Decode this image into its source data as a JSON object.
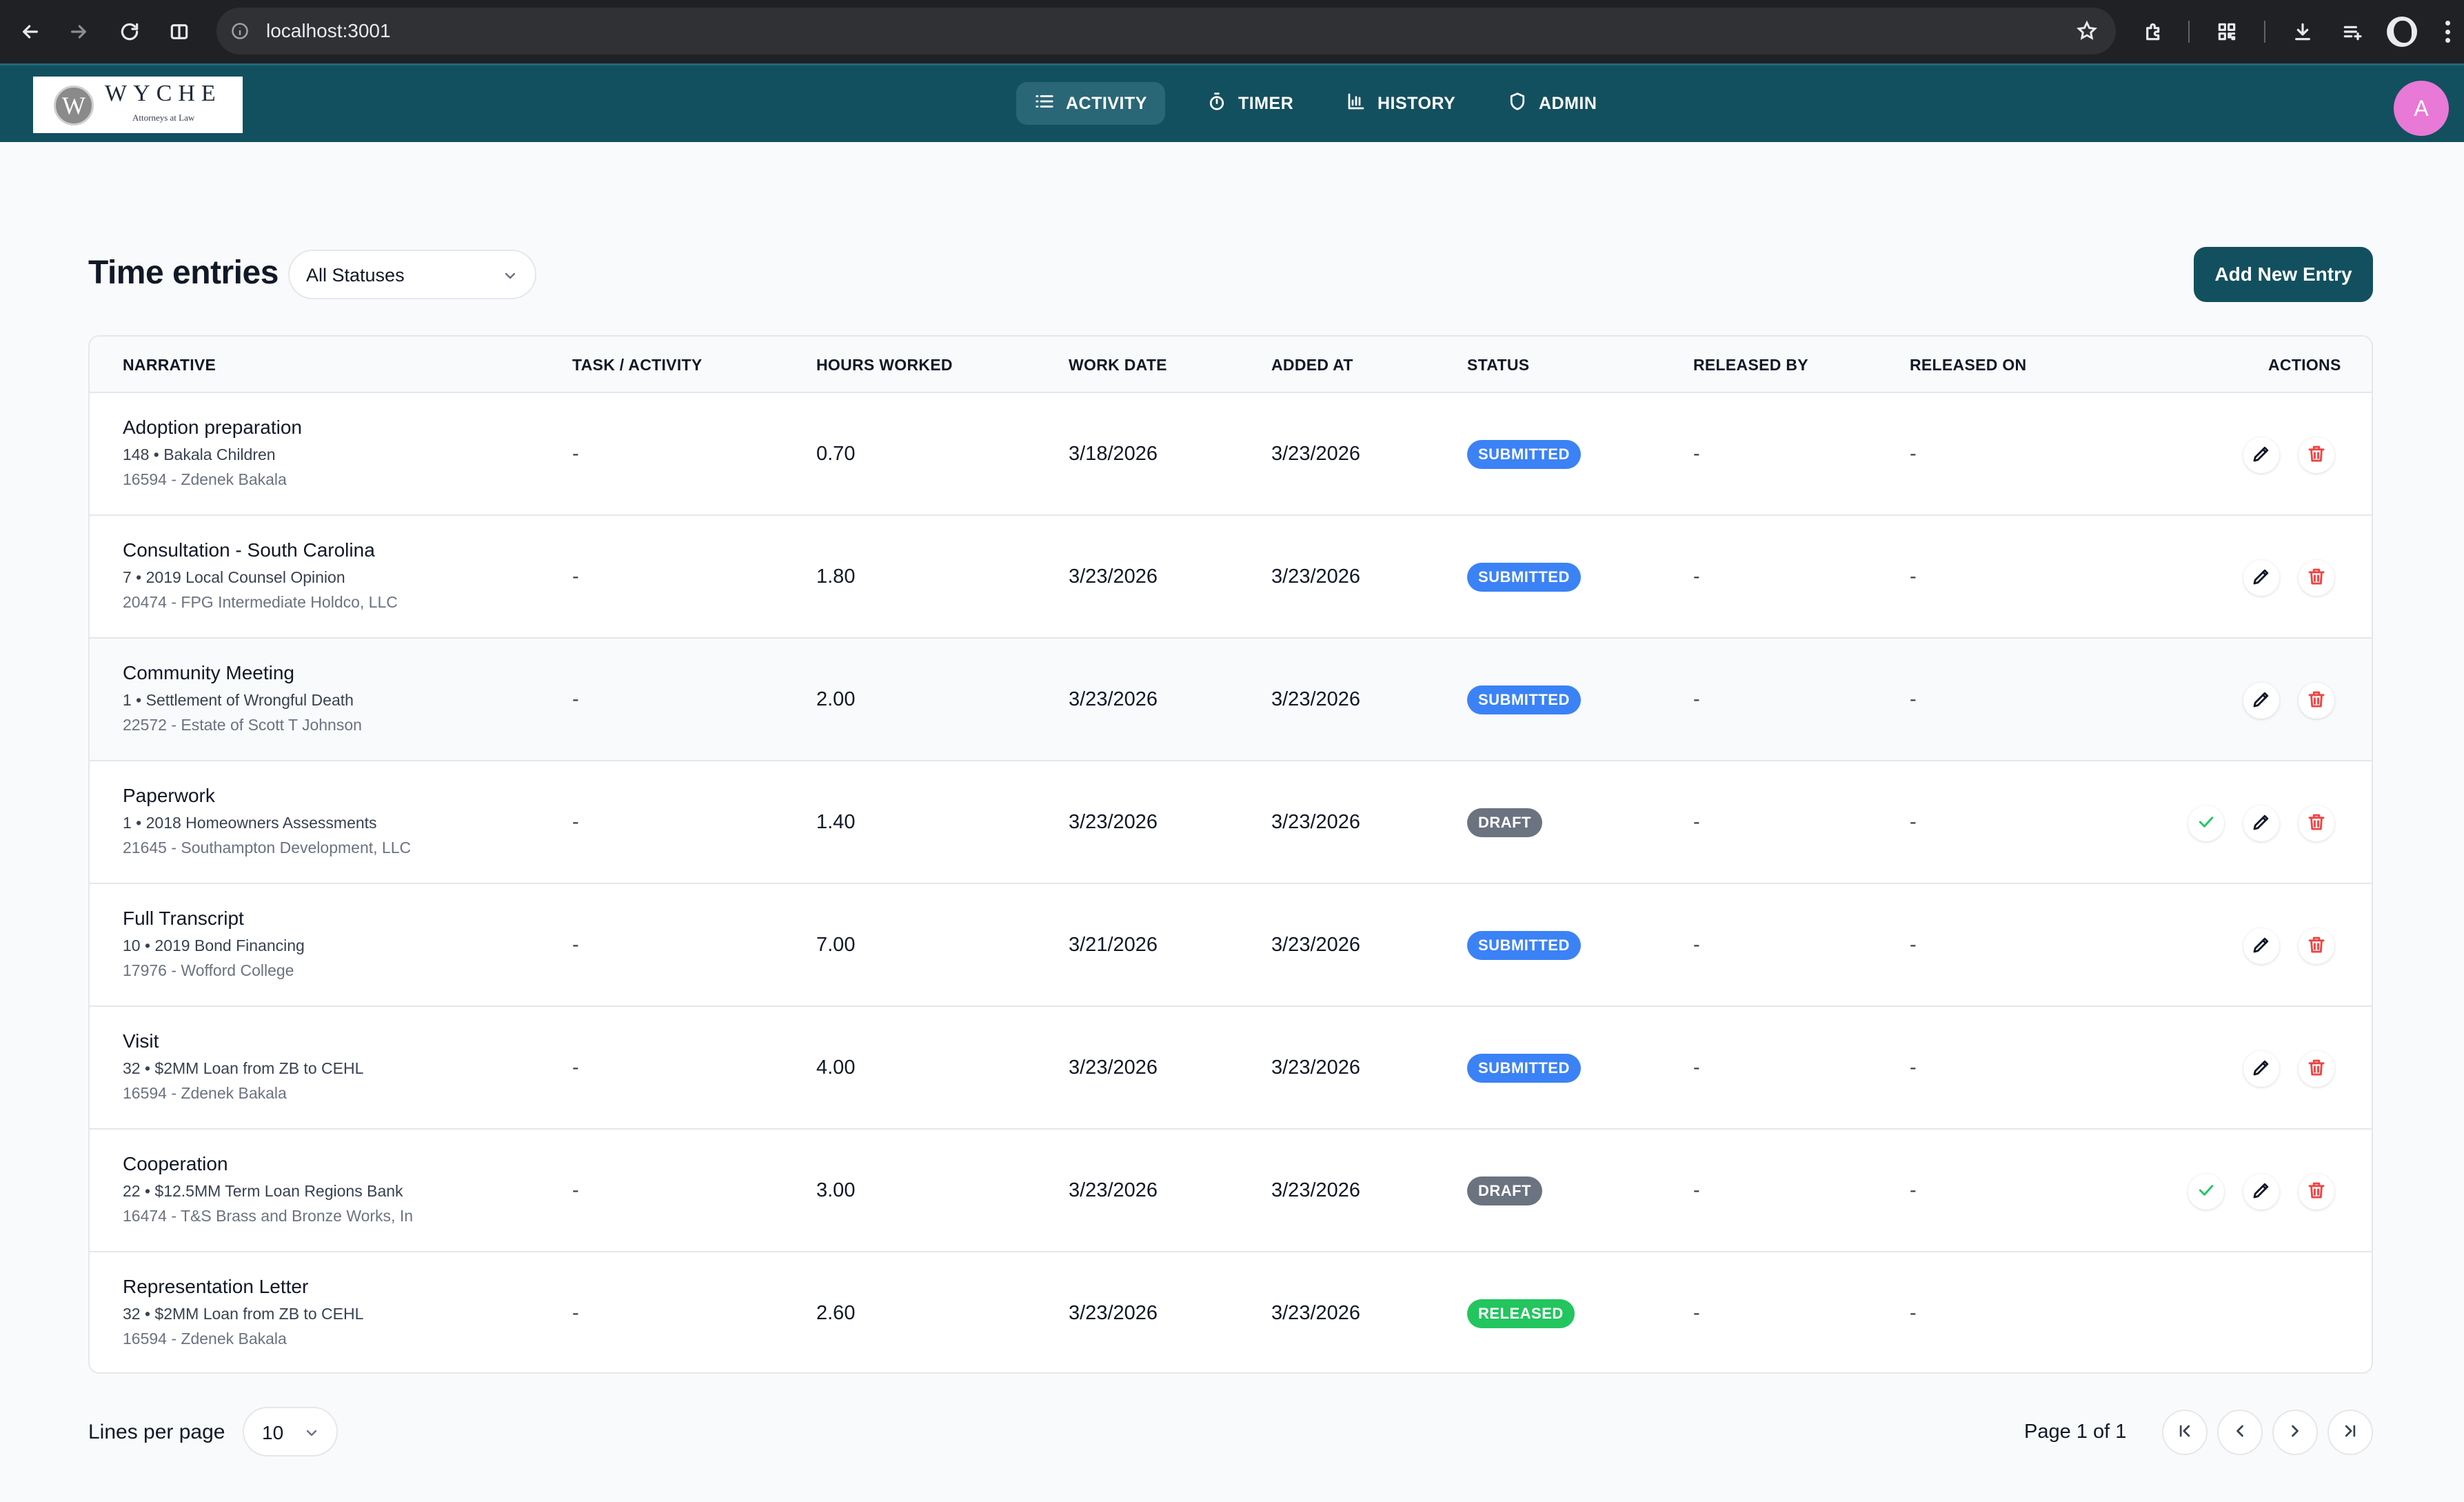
{
  "browser": {
    "url": "localhost:3001"
  },
  "header": {
    "logo": {
      "name": "WYCHE",
      "tagline": "Attorneys at Law",
      "mark": "W"
    },
    "nav": [
      {
        "label": "ACTIVITY",
        "icon": "list-icon",
        "active": true
      },
      {
        "label": "TIMER",
        "icon": "stopwatch-icon",
        "active": false
      },
      {
        "label": "HISTORY",
        "icon": "bar-chart-icon",
        "active": false
      },
      {
        "label": "ADMIN",
        "icon": "shield-icon",
        "active": false
      }
    ],
    "avatar_initial": "A"
  },
  "page": {
    "title": "Time entries",
    "status_filter": "All Statuses",
    "add_button": "Add New Entry"
  },
  "table": {
    "columns": {
      "narrative": "NARRATIVE",
      "task": "TASK / ACTIVITY",
      "hours": "HOURS WORKED",
      "work_date": "WORK DATE",
      "added_at": "ADDED AT",
      "status": "STATUS",
      "released_by": "RELEASED BY",
      "released_on": "RELEASED ON",
      "actions": "ACTIONS"
    },
    "rows": [
      {
        "narrative": "Adoption preparation",
        "matter": "148 • Bakala Children",
        "client": "16594 - Zdenek Bakala",
        "task": "-",
        "hours": "0.70",
        "work_date": "3/18/2026",
        "added_at": "3/23/2026",
        "status": "SUBMITTED",
        "released_by": "-",
        "released_on": "-"
      },
      {
        "narrative": "Consultation - South Carolina",
        "matter": "7 • 2019 Local Counsel Opinion",
        "client": "20474 - FPG Intermediate Holdco, LLC",
        "task": "-",
        "hours": "1.80",
        "work_date": "3/23/2026",
        "added_at": "3/23/2026",
        "status": "SUBMITTED",
        "released_by": "-",
        "released_on": "-"
      },
      {
        "narrative": "Community Meeting",
        "matter": "1 • Settlement of Wrongful Death",
        "client": "22572 - Estate of Scott T Johnson",
        "task": "-",
        "hours": "2.00",
        "work_date": "3/23/2026",
        "added_at": "3/23/2026",
        "status": "SUBMITTED",
        "released_by": "-",
        "released_on": "-"
      },
      {
        "narrative": "Paperwork",
        "matter": "1 • 2018 Homeowners Assessments",
        "client": "21645 - Southampton Development, LLC",
        "task": "-",
        "hours": "1.40",
        "work_date": "3/23/2026",
        "added_at": "3/23/2026",
        "status": "DRAFT",
        "released_by": "-",
        "released_on": "-"
      },
      {
        "narrative": "Full Transcript",
        "matter": "10 • 2019 Bond Financing",
        "client": "17976 - Wofford College",
        "task": "-",
        "hours": "7.00",
        "work_date": "3/21/2026",
        "added_at": "3/23/2026",
        "status": "SUBMITTED",
        "released_by": "-",
        "released_on": "-"
      },
      {
        "narrative": "Visit",
        "matter": "32 • $2MM Loan from ZB to CEHL",
        "client": "16594 - Zdenek Bakala",
        "task": "-",
        "hours": "4.00",
        "work_date": "3/23/2026",
        "added_at": "3/23/2026",
        "status": "SUBMITTED",
        "released_by": "-",
        "released_on": "-"
      },
      {
        "narrative": "Cooperation",
        "matter": "22 • $12.5MM Term Loan Regions Bank",
        "client": "16474 - T&S Brass and Bronze Works, In",
        "task": "-",
        "hours": "3.00",
        "work_date": "3/23/2026",
        "added_at": "3/23/2026",
        "status": "DRAFT",
        "released_by": "-",
        "released_on": "-"
      },
      {
        "narrative": "Representation Letter",
        "matter": "32 • $2MM Loan from ZB to CEHL",
        "client": "16594 - Zdenek Bakala",
        "task": "-",
        "hours": "2.60",
        "work_date": "3/23/2026",
        "added_at": "3/23/2026",
        "status": "RELEASED",
        "released_by": "-",
        "released_on": "-"
      }
    ]
  },
  "status_colors": {
    "SUBMITTED": "#3b82f6",
    "DRAFT": "#6b7280",
    "RELEASED": "#22c55e"
  },
  "footer": {
    "lines_per_page_label": "Lines per page",
    "lines_per_page": "10",
    "page_info": "Page 1 of 1"
  },
  "colors": {
    "brand": "#13505f",
    "delete": "#ef4444",
    "approve": "#22c55e"
  }
}
